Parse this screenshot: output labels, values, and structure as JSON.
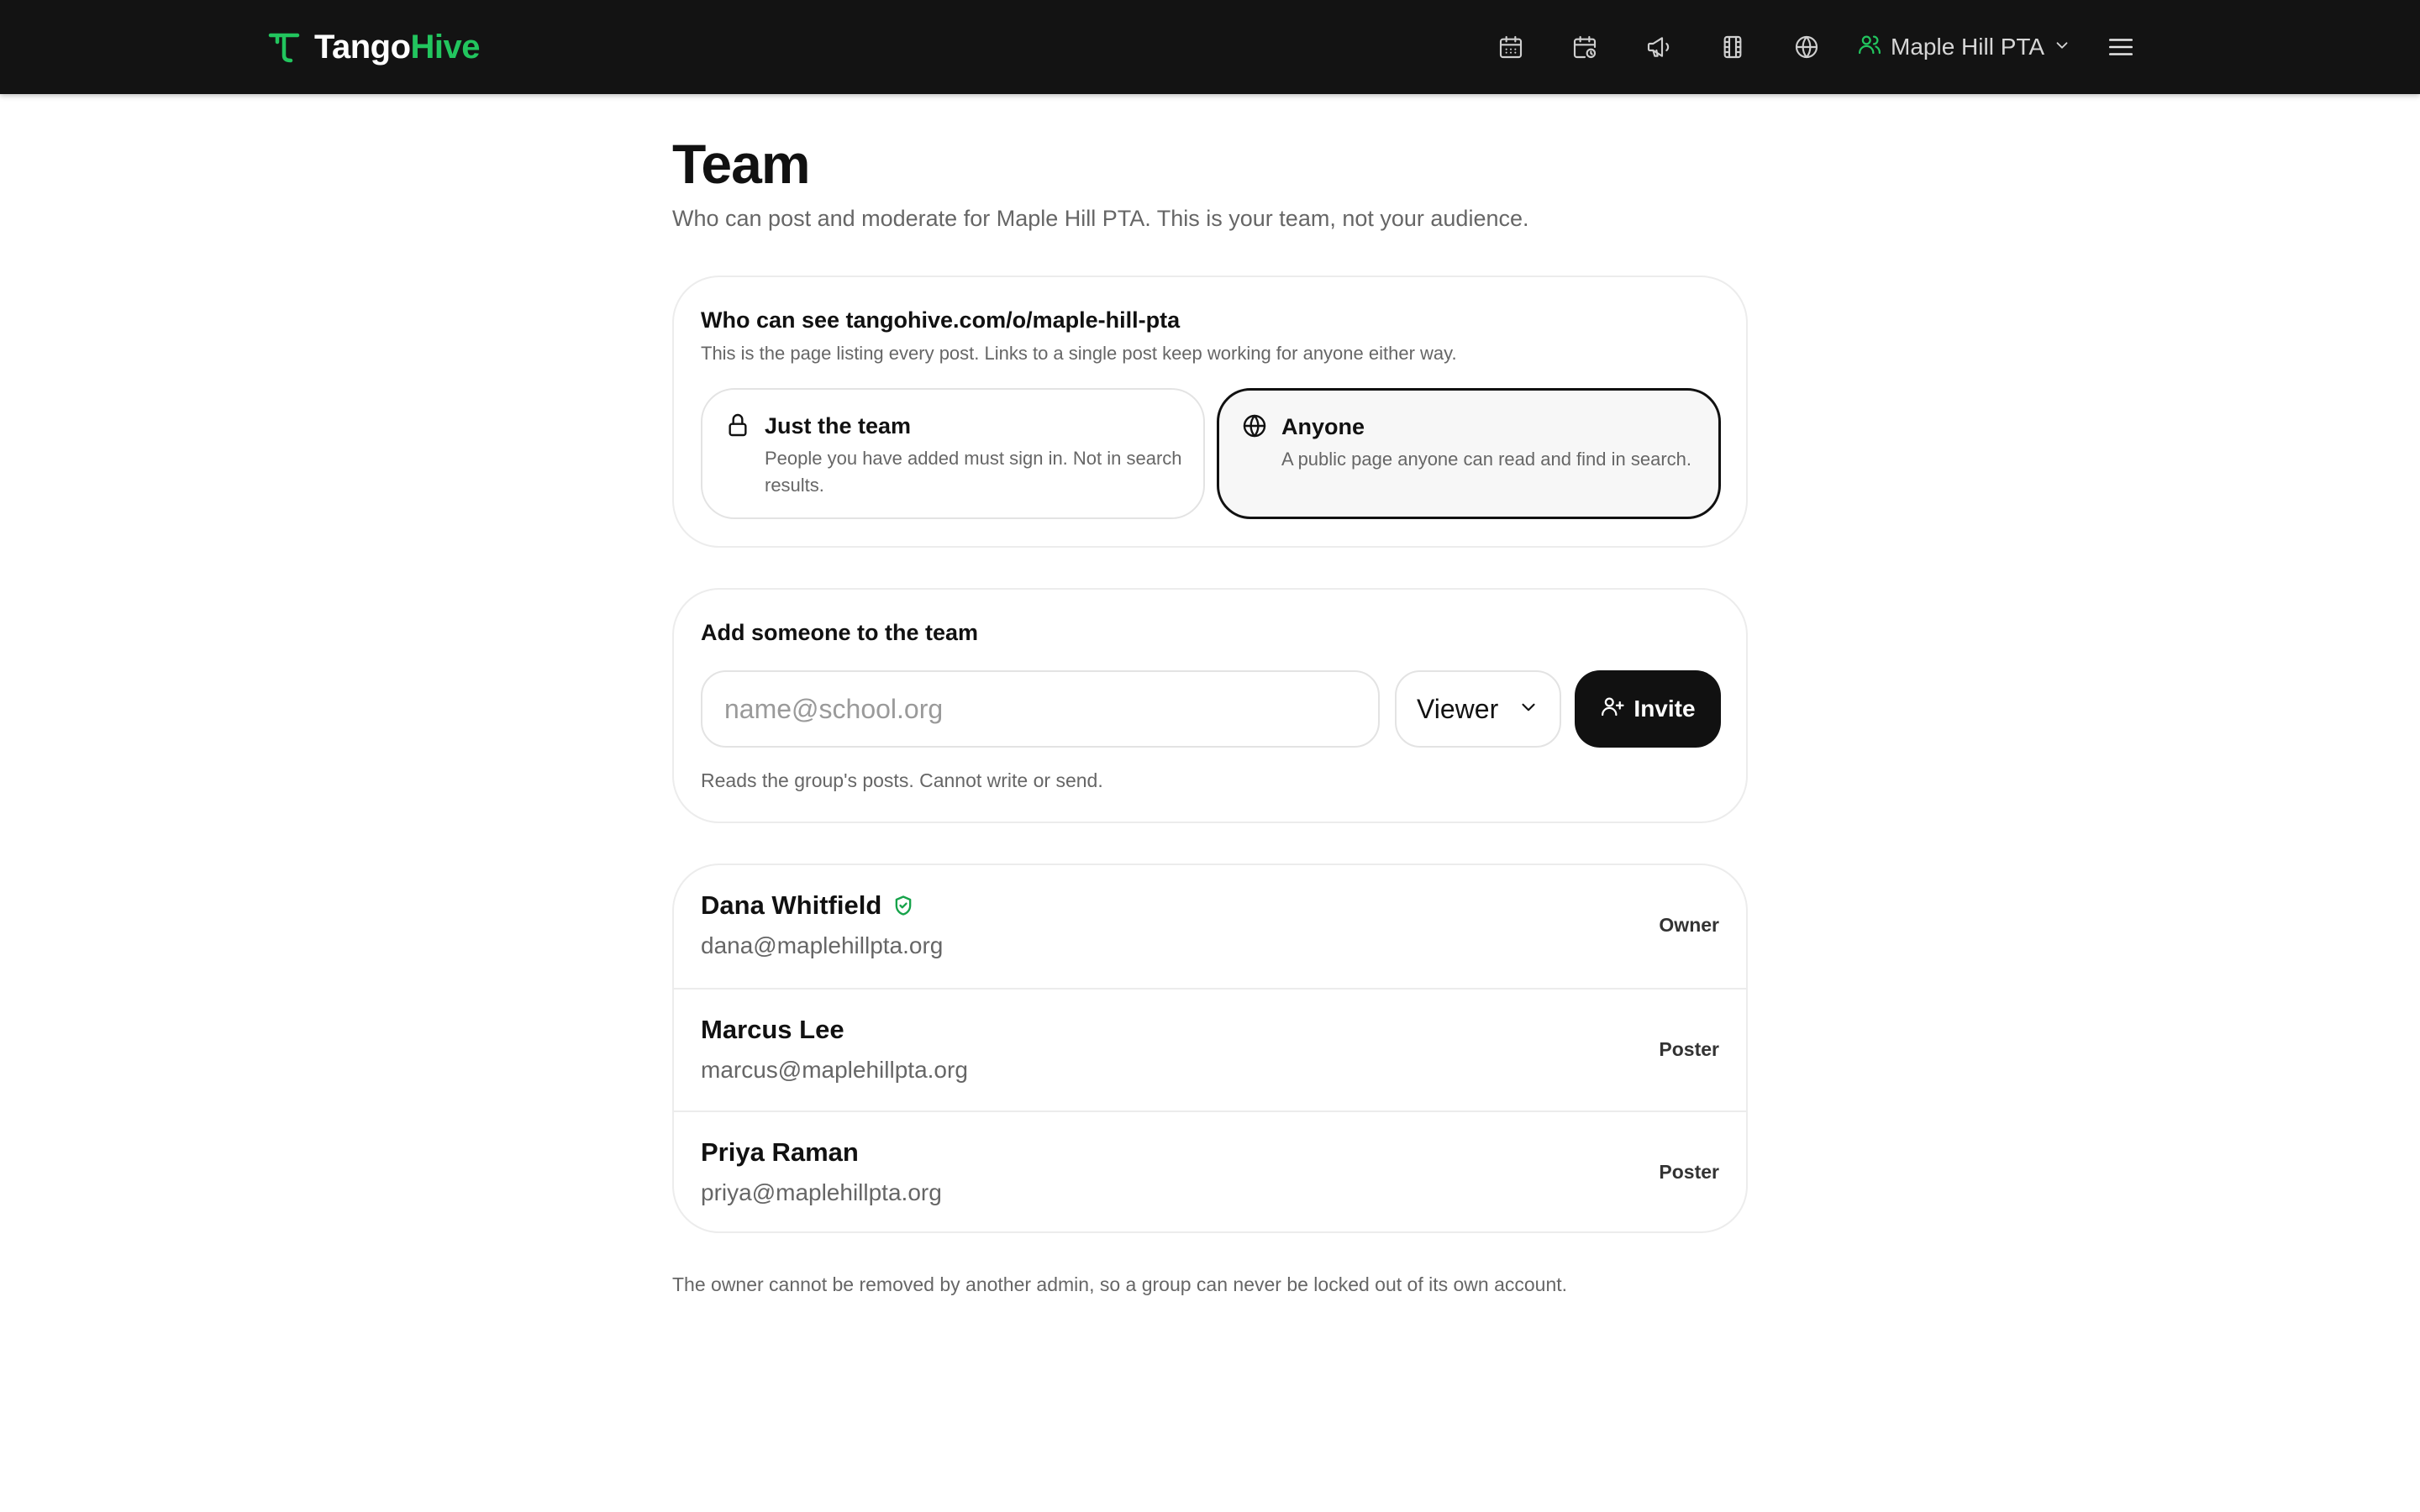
{
  "brand": {
    "part1": "Tango",
    "part2": "Hive",
    "accent": "#22c55e"
  },
  "nav": {
    "icons": [
      "calendar-icon",
      "calendar-clock-icon",
      "megaphone-icon",
      "film-icon",
      "globe-icon"
    ],
    "org_name": "Maple Hill PTA"
  },
  "page": {
    "title": "Team",
    "subtitle": "Who can post and moderate for Maple Hill PTA. This is your team, not your audience."
  },
  "visibility": {
    "title": "Who can see tangohive.com/o/maple-hill-pta",
    "description": "This is the page listing every post. Links to a single post keep working for anyone either way.",
    "options": [
      {
        "title": "Just the team",
        "description": "People you have added must sign in. Not in search results.",
        "selected": false
      },
      {
        "title": "Anyone",
        "description": "A public page anyone can read and find in search.",
        "selected": true
      }
    ]
  },
  "add_member": {
    "title": "Add someone to the team",
    "email_placeholder": "name@school.org",
    "email_value": "",
    "role_selected": "Viewer",
    "invite_label": "Invite",
    "hint": "Reads the group's posts. Cannot write or send."
  },
  "members": [
    {
      "name": "Dana Whitfield",
      "email": "dana@maplehillpta.org",
      "role": "Owner",
      "verified": true
    },
    {
      "name": "Marcus Lee",
      "email": "marcus@maplehillpta.org",
      "role": "Poster",
      "verified": false
    },
    {
      "name": "Priya Raman",
      "email": "priya@maplehillpta.org",
      "role": "Poster",
      "verified": false
    }
  ],
  "footnote": "The owner cannot be removed by another admin, so a group can never be locked out of its own account."
}
